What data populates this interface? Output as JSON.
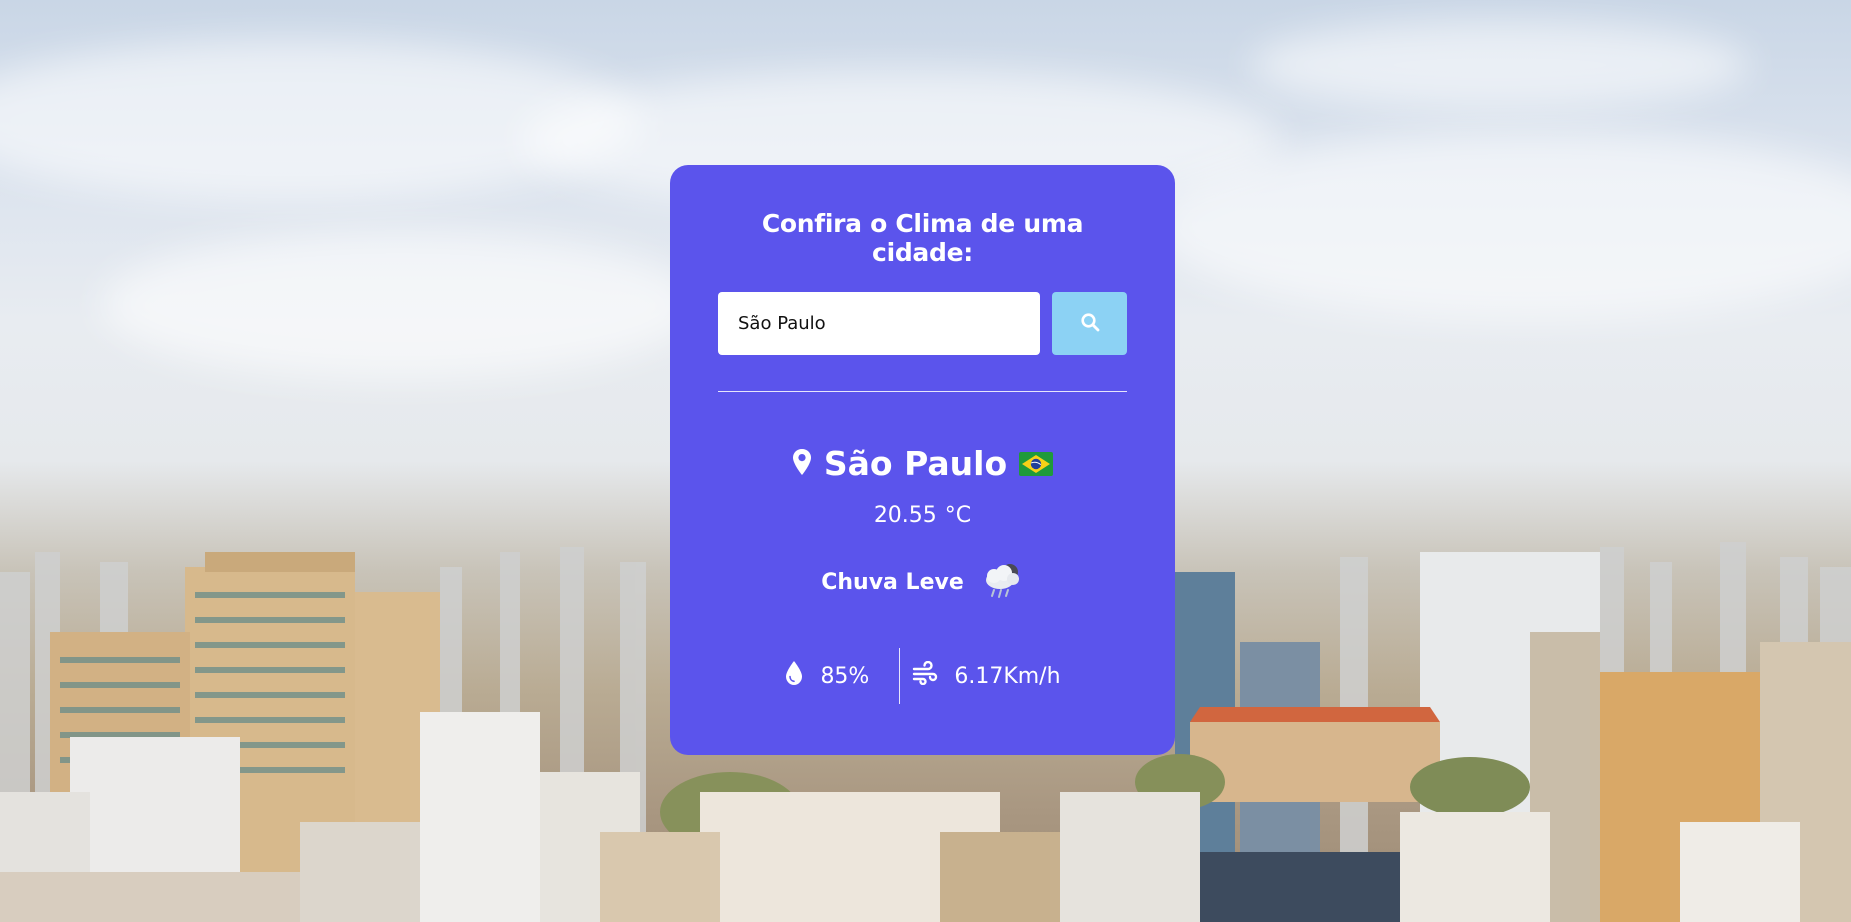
{
  "card": {
    "title": "Confira o Clima de uma cidade:",
    "accent_color": "#5b54ec",
    "search_button_color": "#8cd2f4"
  },
  "search": {
    "value": "São Paulo",
    "button_icon": "search-icon"
  },
  "weather": {
    "location_icon": "map-pin-icon",
    "city": "São Paulo",
    "country_flag": "brazil-flag-icon",
    "temperature": "20.55",
    "temperature_unit": "°C",
    "condition": "Chuva Leve",
    "condition_icon": "rain-cloud-icon",
    "humidity_icon": "droplet-icon",
    "humidity": "85%",
    "wind_icon": "wind-icon",
    "wind": "6.17Km/h"
  }
}
